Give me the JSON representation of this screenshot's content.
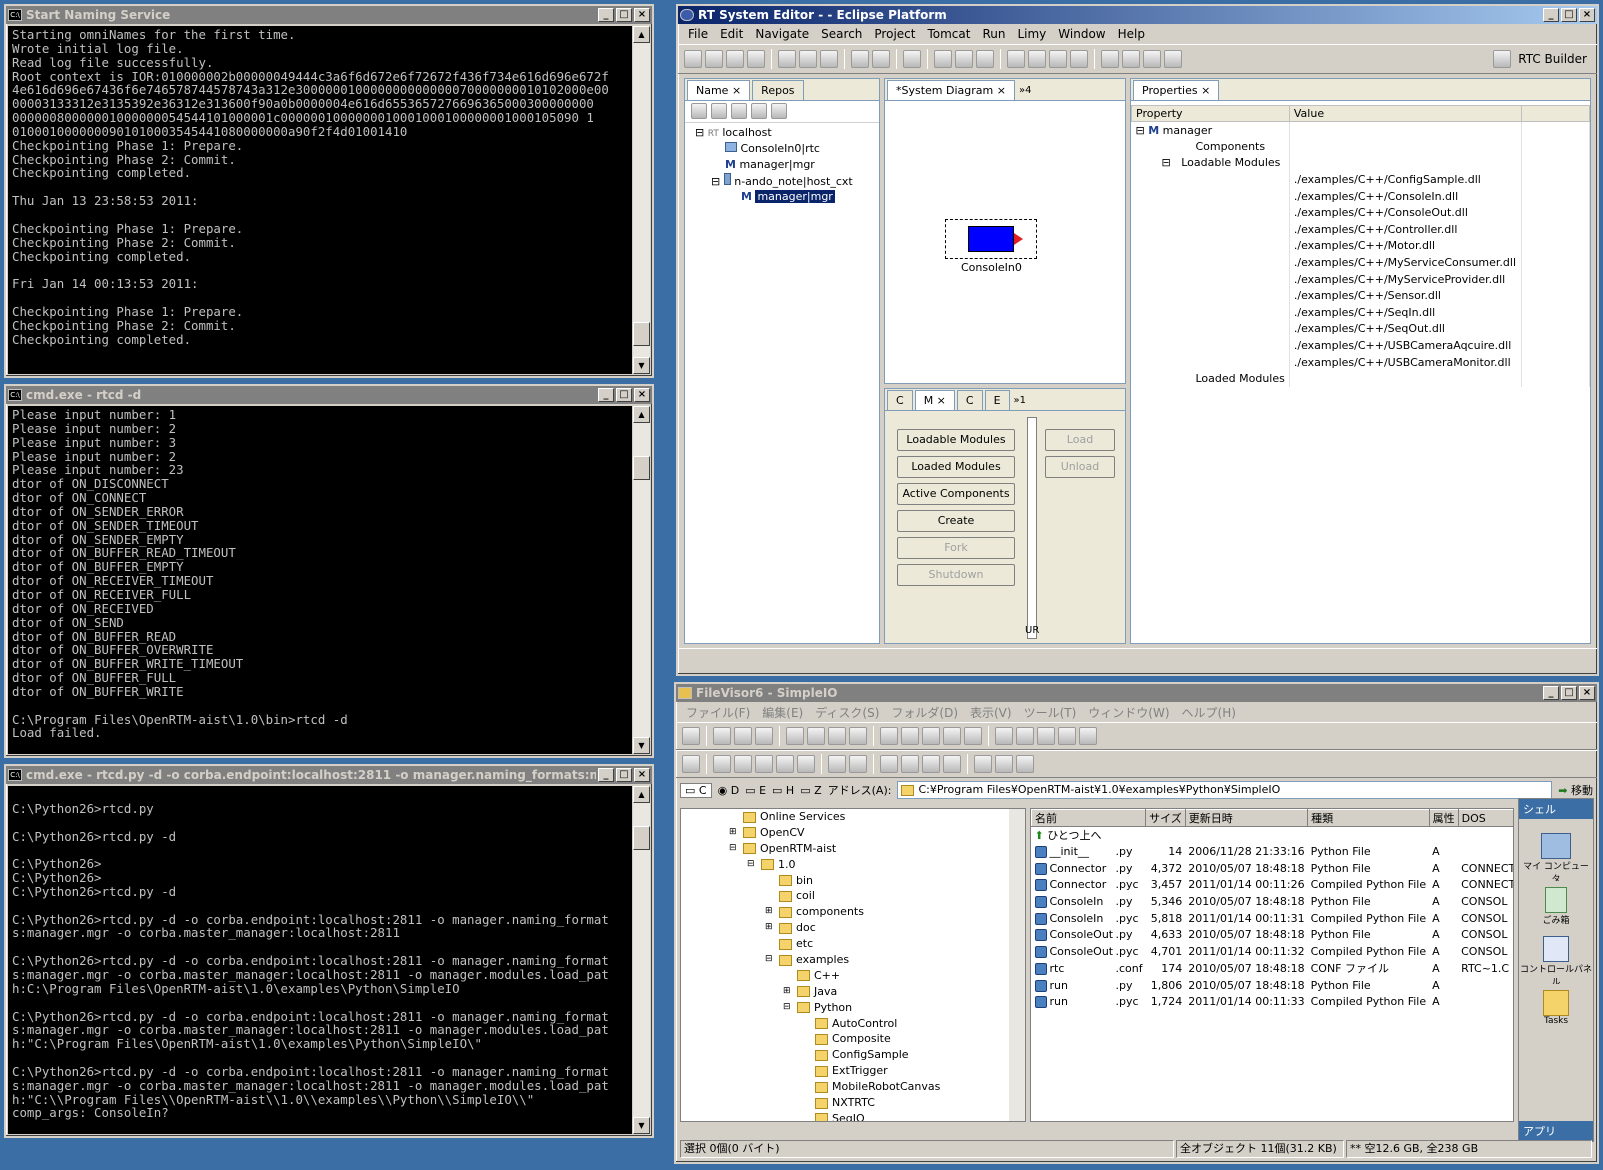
{
  "naming": {
    "title": "Start Naming Service",
    "text": "Starting omniNames for the first time.\nWrote initial log file.\nRead log file successfully.\nRoot context is IOR:010000002b00000049444c3a6f6d672e6f72672f436f734e616d696e672f\n4e616d696e67436f6e746578744578743a312e300000010000000000000070000000010102000e00\n00003133312e3135392e36312e313600f90a0b0000004e616d6553657276696365000300000000\n00000080000001000000054544101000001c0000001000000010001000100000001000105090 1\n0100010000000901010003545441080000000a90f2f4d01001410\nCheckpointing Phase 1: Prepare.\nCheckpointing Phase 2: Commit.\nCheckpointing completed.\n\nThu Jan 13 23:58:53 2011:\n\nCheckpointing Phase 1: Prepare.\nCheckpointing Phase 2: Commit.\nCheckpointing completed.\n\nFri Jan 14 00:13:53 2011:\n\nCheckpointing Phase 1: Prepare.\nCheckpointing Phase 2: Commit.\nCheckpointing completed."
  },
  "rtcd": {
    "title": "cmd.exe - rtcd -d",
    "text": "Please input number: 1\nPlease input number: 2\nPlease input number: 3\nPlease input number: 2\nPlease input number: 23\ndtor of ON_DISCONNECT\ndtor of ON_CONNECT\ndtor of ON_SENDER_ERROR\ndtor of ON_SENDER_TIMEOUT\ndtor of ON_SENDER_EMPTY\ndtor of ON_BUFFER_READ_TIMEOUT\ndtor of ON_BUFFER_EMPTY\ndtor of ON_RECEIVER_TIMEOUT\ndtor of ON_RECEIVER_FULL\ndtor of ON_RECEIVED\ndtor of ON_SEND\ndtor of ON_BUFFER_READ\ndtor of ON_BUFFER_OVERWRITE\ndtor of ON_BUFFER_WRITE_TIMEOUT\ndtor of ON_BUFFER_FULL\ndtor of ON_BUFFER_WRITE\n\nC:\\Program Files\\OpenRTM-aist\\1.0\\bin>rtcd -d\nLoad failed."
  },
  "rtcdpy": {
    "title": "cmd.exe - rtcd.py -d -o corba.endpoint:localhost:2811 -o manager.naming_formats:manager.mgr...",
    "text": "\nC:\\Python26>rtcd.py\n\nC:\\Python26>rtcd.py -d\n\nC:\\Python26>\nC:\\Python26>\nC:\\Python26>rtcd.py -d\n\nC:\\Python26>rtcd.py -d -o corba.endpoint:localhost:2811 -o manager.naming_format\ns:manager.mgr -o corba.master_manager:localhost:2811\n\nC:\\Python26>rtcd.py -d -o corba.endpoint:localhost:2811 -o manager.naming_format\ns:manager.mgr -o corba.master_manager:localhost:2811 -o manager.modules.load_pat\nh:C:\\Program Files\\OpenRTM-aist\\1.0\\examples\\Python\\SimpleIO\n\nC:\\Python26>rtcd.py -d -o corba.endpoint:localhost:2811 -o manager.naming_format\ns:manager.mgr -o corba.master_manager:localhost:2811 -o manager.modules.load_pat\nh:\"C:\\Program Files\\OpenRTM-aist\\1.0\\examples\\Python\\SimpleIO\\\"\n\nC:\\Python26>rtcd.py -d -o corba.endpoint:localhost:2811 -o manager.naming_format\ns:manager.mgr -o corba.master_manager:localhost:2811 -o manager.modules.load_pat\nh:\"C:\\\\Program Files\\\\OpenRTM-aist\\\\1.0\\\\examples\\\\Python\\\\SimpleIO\\\\\"\ncomp_args: ConsoleIn?"
  },
  "eclipse": {
    "title": "RT System Editor - - Eclipse Platform",
    "menu": [
      "File",
      "Edit",
      "Navigate",
      "Search",
      "Project",
      "Tomcat",
      "Run",
      "Limy",
      "Window",
      "Help"
    ],
    "perspective": "RTC Builder",
    "name_tab": "Name",
    "repos_tab": "Repos",
    "tree": [
      "localhost",
      "ConsoleIn0|rtc",
      "manager|mgr",
      "n-ando_note|host_cxt",
      "manager|mgr"
    ],
    "diagram_tab": "*System Diagram",
    "diagram_more": "»4",
    "component_label": "ConsoleIn0",
    "mgr_tabs": [
      "C",
      "M",
      "C",
      "E",
      "»1"
    ],
    "buttons": [
      "Loadable Modules",
      "Loaded Modules",
      "Active Components",
      "Create",
      "Fork",
      "Shutdown"
    ],
    "side_buttons": [
      "Load",
      "Unload"
    ],
    "ur": "UR",
    "props_tab": "Properties",
    "props_head": [
      "Property",
      "Value"
    ],
    "props_manager": "manager",
    "props_components": "Components",
    "props_loadable": "Loadable Modules",
    "props_loaded": "Loaded Modules",
    "modules": [
      "./examples/C++/ConfigSample.dll",
      "./examples/C++/ConsoleIn.dll",
      "./examples/C++/ConsoleOut.dll",
      "./examples/C++/Controller.dll",
      "./examples/C++/Motor.dll",
      "./examples/C++/MyServiceConsumer.dll",
      "./examples/C++/MyServiceProvider.dll",
      "./examples/C++/Sensor.dll",
      "./examples/C++/SeqIn.dll",
      "./examples/C++/SeqOut.dll",
      "./examples/C++/USBCameraAqcuire.dll",
      "./examples/C++/USBCameraMonitor.dll"
    ]
  },
  "filevisor": {
    "title": "FileVisor6 - SimpleIO",
    "menu": [
      "ファイル(F)",
      "編集(E)",
      "ディスク(S)",
      "フォルダ(D)",
      "表示(V)",
      "ツール(T)",
      "ウィンドウ(W)",
      "ヘルプ(H)"
    ],
    "drives": [
      "C",
      "D",
      "E",
      "H",
      "Z"
    ],
    "address_label": "アドレス(A):",
    "address": "C:¥Program Files¥OpenRTM-aist¥1.0¥examples¥Python¥SimpleIO",
    "go": "移動",
    "folders": [
      {
        "name": "Online Services",
        "depth": 0,
        "exp": ""
      },
      {
        "name": "OpenCV",
        "depth": 0,
        "exp": "+"
      },
      {
        "name": "OpenRTM-aist",
        "depth": 0,
        "exp": "-"
      },
      {
        "name": "1.0",
        "depth": 1,
        "exp": "-"
      },
      {
        "name": "bin",
        "depth": 2,
        "exp": ""
      },
      {
        "name": "coil",
        "depth": 2,
        "exp": ""
      },
      {
        "name": "components",
        "depth": 2,
        "exp": "+"
      },
      {
        "name": "doc",
        "depth": 2,
        "exp": "+"
      },
      {
        "name": "etc",
        "depth": 2,
        "exp": ""
      },
      {
        "name": "examples",
        "depth": 2,
        "exp": "-"
      },
      {
        "name": "C++",
        "depth": 3,
        "exp": ""
      },
      {
        "name": "Java",
        "depth": 3,
        "exp": "+"
      },
      {
        "name": "Python",
        "depth": 3,
        "exp": "-"
      },
      {
        "name": "AutoControl",
        "depth": 4,
        "exp": ""
      },
      {
        "name": "Composite",
        "depth": 4,
        "exp": ""
      },
      {
        "name": "ConfigSample",
        "depth": 4,
        "exp": ""
      },
      {
        "name": "ExtTrigger",
        "depth": 4,
        "exp": ""
      },
      {
        "name": "MobileRobotCanvas",
        "depth": 4,
        "exp": ""
      },
      {
        "name": "NXTRTC",
        "depth": 4,
        "exp": ""
      },
      {
        "name": "SeqIO",
        "depth": 4,
        "exp": ""
      }
    ],
    "columns": [
      "名前",
      "サイズ",
      "更新日時",
      "種類",
      "属性",
      "DOS"
    ],
    "up": "ひとつ上へ",
    "files": [
      [
        "__init__",
        ".py",
        "14",
        "2006/11/28 21:33:16",
        "Python File",
        "A",
        ""
      ],
      [
        "Connector",
        ".py",
        "4,372",
        "2010/05/07 18:48:18",
        "Python File",
        "A",
        "CONNECT"
      ],
      [
        "Connector",
        ".pyc",
        "3,457",
        "2011/01/14 00:11:26",
        "Compiled Python File",
        "A",
        "CONNECT"
      ],
      [
        "ConsoleIn",
        ".py",
        "5,346",
        "2010/05/07 18:48:18",
        "Python File",
        "A",
        "CONSOL"
      ],
      [
        "ConsoleIn",
        ".pyc",
        "5,818",
        "2011/01/14 00:11:31",
        "Compiled Python File",
        "A",
        "CONSOL"
      ],
      [
        "ConsoleOut",
        ".py",
        "4,633",
        "2010/05/07 18:48:18",
        "Python File",
        "A",
        "CONSOL"
      ],
      [
        "ConsoleOut",
        ".pyc",
        "4,701",
        "2011/01/14 00:11:32",
        "Compiled Python File",
        "A",
        "CONSOL"
      ],
      [
        "rtc",
        ".conf",
        "174",
        "2010/05/07 18:48:18",
        "CONF ファイル",
        "A",
        "RTC~1.C"
      ],
      [
        "run",
        ".py",
        "1,806",
        "2010/05/07 18:48:18",
        "Python File",
        "A",
        ""
      ],
      [
        "run",
        ".pyc",
        "1,724",
        "2011/01/14 00:11:33",
        "Compiled Python File",
        "A",
        ""
      ]
    ],
    "shell_label": "シェル",
    "shell_items": [
      "マイ コンピュータ",
      "ごみ箱",
      "コントロールパネル",
      "Tasks"
    ],
    "app_label": "アプリ",
    "status": [
      "選択 0個(0 バイト)",
      "全オブジェクト 11個(31.2 KB)",
      "** 空12.6 GB, 全238 GB"
    ]
  }
}
